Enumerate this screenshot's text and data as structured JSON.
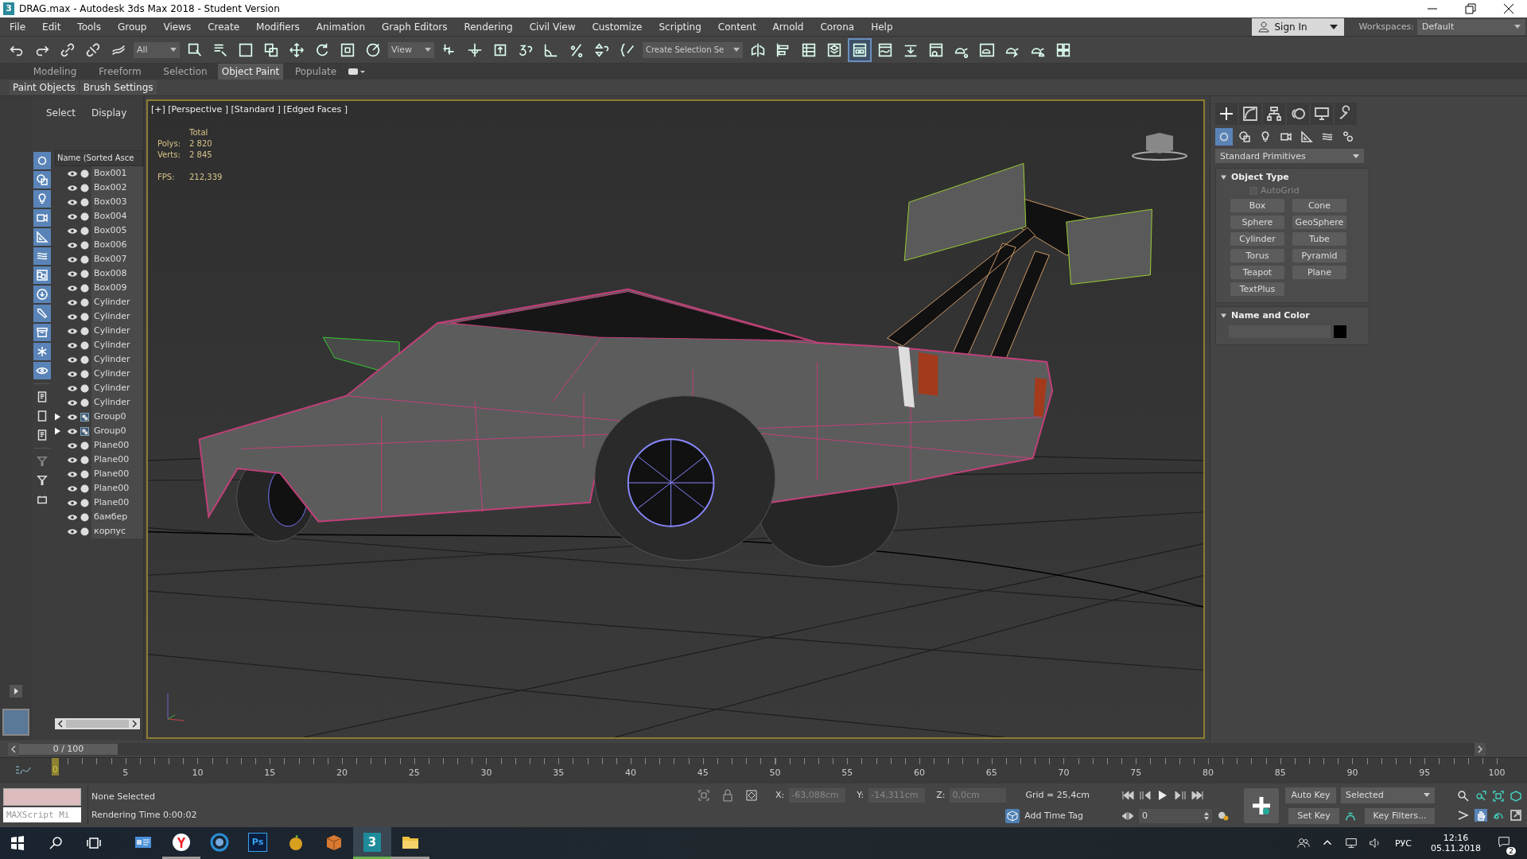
{
  "window": {
    "title": "DRAG.max - Autodesk 3ds Max 2018 - Student Version",
    "app_icon": "3"
  },
  "menu": [
    "File",
    "Edit",
    "Tools",
    "Group",
    "Views",
    "Create",
    "Modifiers",
    "Animation",
    "Graph Editors",
    "Rendering",
    "Civil View",
    "Customize",
    "Scripting",
    "Content",
    "Arnold",
    "Corona",
    "Help"
  ],
  "account": {
    "label": "Sign In"
  },
  "workspaces": {
    "label": "Workspaces:",
    "value": "Default"
  },
  "toolbar": {
    "filter": "All",
    "view": "View",
    "selection_set": "Create Selection Se",
    "explorer_toggle_on": true
  },
  "ribbon_tabs": [
    {
      "label": "Modeling",
      "selected": false
    },
    {
      "label": "Freeform",
      "selected": false
    },
    {
      "label": "Selection",
      "selected": false
    },
    {
      "label": "Object Paint",
      "selected": true
    },
    {
      "label": "Populate",
      "selected": false
    }
  ],
  "ribbon_buttons": [
    "Paint Objects",
    "Brush Settings"
  ],
  "scene_explorer": {
    "tabs": [
      "Select",
      "Display"
    ],
    "column": "Name (Sorted Asce",
    "filters": [
      {
        "kind": "geometry",
        "on": true
      },
      {
        "kind": "shapes",
        "on": true
      },
      {
        "kind": "light",
        "on": true
      },
      {
        "kind": "camera",
        "on": true
      },
      {
        "kind": "helper",
        "on": true
      },
      {
        "kind": "spacewarp",
        "on": true
      },
      {
        "kind": "group",
        "on": true
      },
      {
        "kind": "xref",
        "on": true
      },
      {
        "kind": "bone",
        "on": true
      },
      {
        "kind": "container",
        "on": true
      },
      {
        "kind": "particle",
        "on": true
      },
      {
        "kind": "hidden",
        "on": true
      }
    ],
    "items": [
      {
        "name": "Box001",
        "kind": "object"
      },
      {
        "name": "Box002",
        "kind": "object"
      },
      {
        "name": "Box003",
        "kind": "object"
      },
      {
        "name": "Box004",
        "kind": "object"
      },
      {
        "name": "Box005",
        "kind": "object"
      },
      {
        "name": "Box006",
        "kind": "object"
      },
      {
        "name": "Box007",
        "kind": "object"
      },
      {
        "name": "Box008",
        "kind": "object"
      },
      {
        "name": "Box009",
        "kind": "object"
      },
      {
        "name": "Cylinder",
        "kind": "object"
      },
      {
        "name": "Cylinder",
        "kind": "object"
      },
      {
        "name": "Cylinder",
        "kind": "object"
      },
      {
        "name": "Cylinder",
        "kind": "object"
      },
      {
        "name": "Cylinder",
        "kind": "object"
      },
      {
        "name": "Cylinder",
        "kind": "object"
      },
      {
        "name": "Cylinder",
        "kind": "object"
      },
      {
        "name": "Cylinder",
        "kind": "object"
      },
      {
        "name": "Group0",
        "kind": "group"
      },
      {
        "name": "Group0",
        "kind": "group"
      },
      {
        "name": "Plane00",
        "kind": "object"
      },
      {
        "name": "Plane00",
        "kind": "object"
      },
      {
        "name": "Plane00",
        "kind": "object"
      },
      {
        "name": "Plane00",
        "kind": "object"
      },
      {
        "name": "Plane00",
        "kind": "object"
      },
      {
        "name": "бамбер",
        "kind": "object"
      },
      {
        "name": "корпус",
        "kind": "object"
      }
    ]
  },
  "viewport": {
    "label": "[+] [Perspective ] [Standard ] [Edged Faces ]",
    "stats_title": "Total",
    "stats": [
      {
        "label": "Polys:",
        "value": "2 820"
      },
      {
        "label": "Verts:",
        "value": "2 845"
      }
    ],
    "fps": {
      "label": "FPS:",
      "value": "212,339"
    }
  },
  "command_panel": {
    "category": "Standard Primitives",
    "object_type": {
      "title": "Object Type",
      "autogrid": "AutoGrid",
      "autogrid_checked": false,
      "buttons": [
        "Box",
        "Cone",
        "Sphere",
        "GeoSphere",
        "Cylinder",
        "Tube",
        "Torus",
        "Pyramid",
        "Teapot",
        "Plane",
        "TextPlus"
      ]
    },
    "name_color": {
      "title": "Name and Color",
      "color": "#000000"
    }
  },
  "time_slider": {
    "label": "0 / 100",
    "level": 0
  },
  "timeline": {
    "current": "0",
    "ticks": [
      "5",
      "10",
      "15",
      "20",
      "25",
      "30",
      "35",
      "40",
      "45",
      "50",
      "55",
      "60",
      "65",
      "70",
      "75",
      "80",
      "85",
      "90",
      "95",
      "100"
    ]
  },
  "status": {
    "maxscript": "MAXScript Mi",
    "selection": "None Selected",
    "prompt": "Rendering Time  0:00:02",
    "x_label": "X:",
    "x": "-63,088cm",
    "y_label": "Y:",
    "y": "-14,311cm",
    "z_label": "Z:",
    "z": "0,0cm",
    "grid": "Grid = 25,4cm",
    "time_tag": "Add Time Tag",
    "auto_key": "Auto Key",
    "set_key": "Set Key",
    "key_mode": "Selected",
    "key_filters": "Key Filters...",
    "frame": "0"
  },
  "taskbar": {
    "apps": [
      {
        "kind": "store",
        "running": false,
        "active": false
      },
      {
        "kind": "yandex",
        "running": true,
        "active": false
      },
      {
        "kind": "browser",
        "running": false,
        "active": false
      },
      {
        "kind": "photoshop",
        "label": "Ps",
        "running": false,
        "active": false
      },
      {
        "kind": "fruit",
        "running": false,
        "active": false
      },
      {
        "kind": "box",
        "running": false,
        "active": false
      },
      {
        "kind": "max",
        "label": "3",
        "running": true,
        "active": true
      },
      {
        "kind": "folder",
        "running": true,
        "active": false
      }
    ],
    "language": "РУС",
    "time": "12:16",
    "date": "05.11.2018",
    "notifications": "2"
  }
}
